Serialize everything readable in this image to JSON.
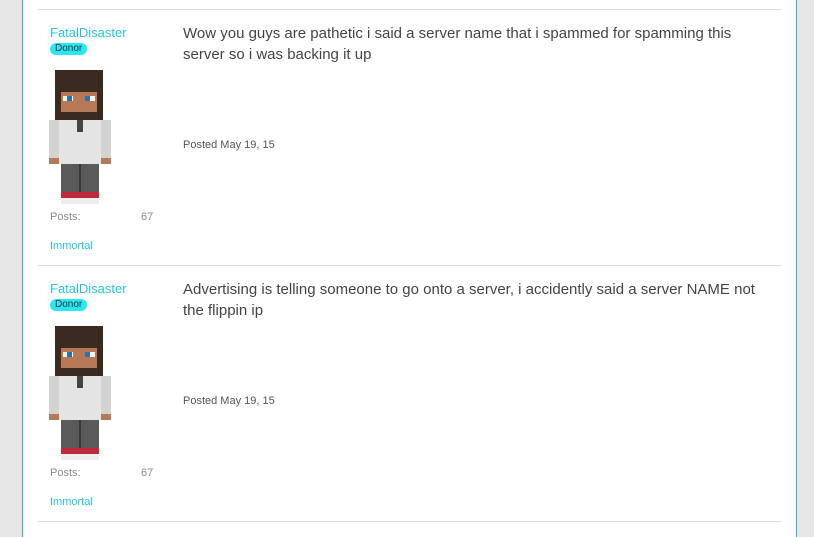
{
  "posts": [
    {
      "author": "FatalDisaster",
      "badge": "Donor",
      "stat_label": "Posts:",
      "stat_value": "67",
      "rank": "Immortal",
      "text": "Wow you guys are pathetic i said a server name that i spammed for spamming this server so i was backing it up",
      "posted": "Posted May 19, 15"
    },
    {
      "author": "FatalDisaster",
      "badge": "Donor",
      "stat_label": "Posts:",
      "stat_value": "67",
      "rank": "Immortal",
      "text": "Advertising is telling someone to go onto a server, i accidently said a server NAME not the flippin ip",
      "posted": "Posted May 19, 15"
    }
  ],
  "colors": {
    "link": "#27c3e3",
    "badge": "#27e8f5",
    "frame_border": "#3aa9c8"
  },
  "icons": {
    "avatar": "minecraft-skin-avatar"
  }
}
